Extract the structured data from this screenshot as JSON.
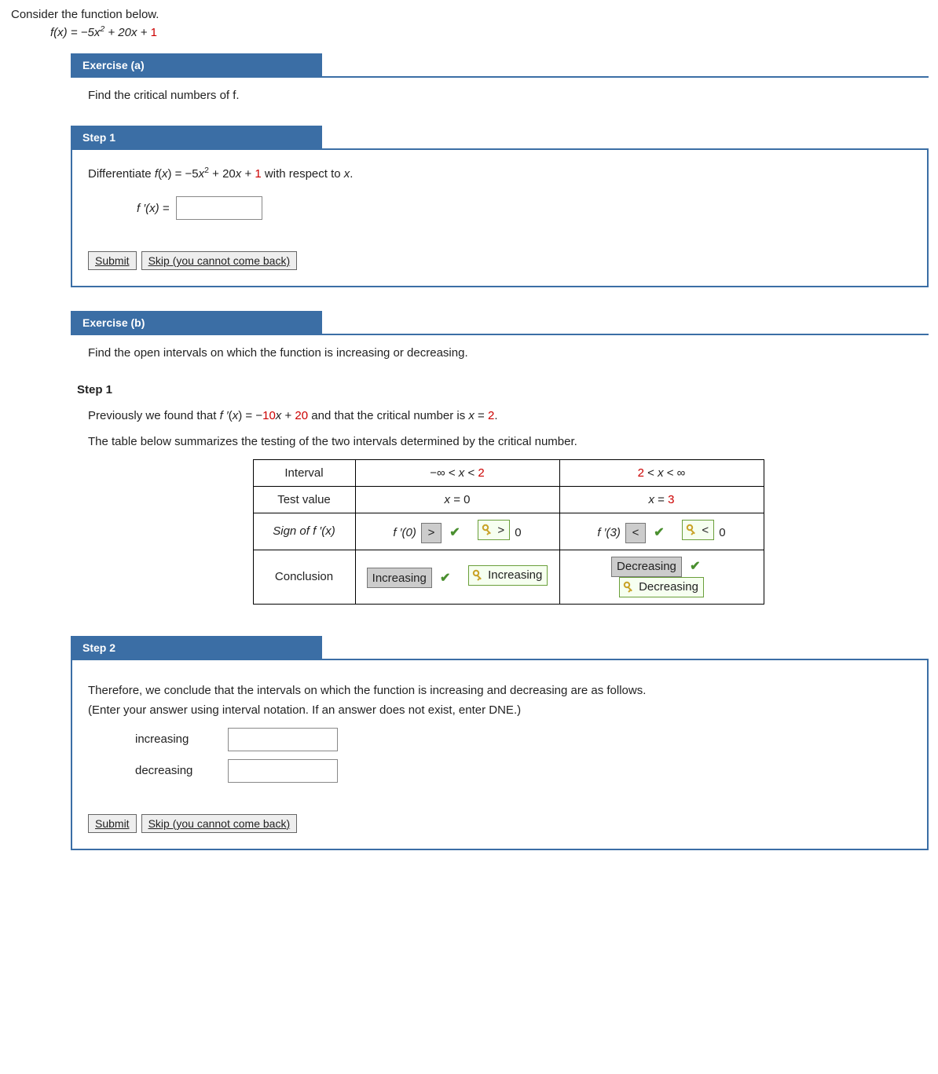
{
  "intro": "Consider the function below.",
  "function_html": "f(x) = −5x<span class='sup'>2</span> + 20x + <span class='num-red'>1</span>",
  "exA": {
    "title": "Exercise (a)",
    "prompt": "Find the critical numbers of f.",
    "step1_title": "Step 1",
    "diff_html": "Differentiate <span class='italic-var'>f</span>(<span class='italic-var'>x</span>) = −5<span class='italic-var'>x</span><span class='sup'>2</span> + 20<span class='italic-var'>x</span> + <span class='num-red'>1</span> with respect to <span class='italic-var'>x</span>.",
    "fprime_label": "f ′(x) =",
    "submit": "Submit",
    "skip": "Skip (you cannot come back)"
  },
  "exB": {
    "title": "Exercise (b)",
    "prompt": "Find the open intervals on which the function is increasing or decreasing.",
    "step1_title": "Step 1",
    "prev_html": "Previously we found that <span class='italic-var'>f ′</span>(<span class='italic-var'>x</span>) = −<span class='num-red'>10</span><span class='italic-var'>x</span> + <span class='num-red'>20</span> and that the critical number is <span class='italic-var'>x</span> = <span class='num-red'>2</span>.",
    "table_intro": "The table below summarizes the testing of the two intervals determined by the critical number.",
    "table": {
      "rows": {
        "interval": "Interval",
        "test": "Test value",
        "sign": "Sign of f ′(x)",
        "concl": "Conclusion"
      },
      "col1": {
        "interval_html": "−∞ < <span class='italic-var'>x</span> < <span class='num-red'>2</span>",
        "test_html": "<span class='italic-var'>x</span> = 0",
        "sign_prefix": "f ′(0)",
        "sign_ans": ">",
        "sign_key": ">",
        "sign_suffix": "0",
        "concl_ans": "Increasing",
        "concl_key": "Increasing"
      },
      "col2": {
        "interval_html": "<span class='num-red'>2</span> < <span class='italic-var'>x</span> < ∞",
        "test_html": "<span class='italic-var'>x</span> = <span class='num-red'>3</span>",
        "sign_prefix": "f ′(3)",
        "sign_ans": "<",
        "sign_key": "<",
        "sign_suffix": "0",
        "concl_ans": "Decreasing",
        "concl_key": "Decreasing"
      }
    },
    "step2_title": "Step 2",
    "step2_text1": "Therefore, we conclude that the intervals on which the function is increasing and decreasing are as follows.",
    "step2_text2": "(Enter your answer using interval notation. If an answer does not exist, enter DNE.)",
    "inc_label": "increasing",
    "dec_label": "decreasing",
    "submit": "Submit",
    "skip": "Skip (you cannot come back)"
  }
}
